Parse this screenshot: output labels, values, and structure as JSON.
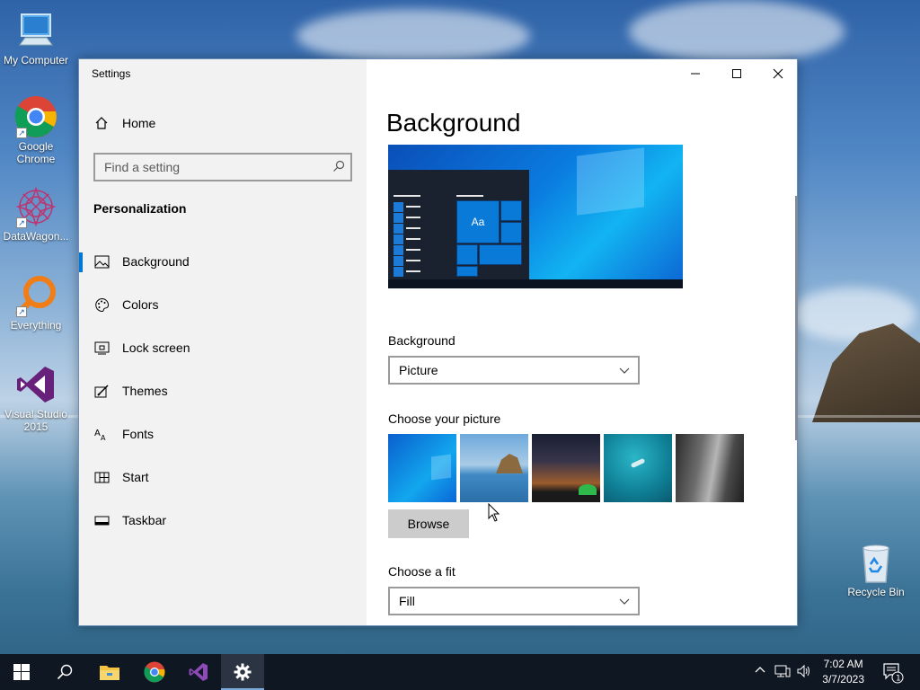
{
  "desktop": {
    "icons": [
      {
        "label": "My Computer",
        "icon": "computer-icon"
      },
      {
        "label": "Google Chrome",
        "icon": "chrome-icon"
      },
      {
        "label": "DataWagon...",
        "icon": "datawagon-icon"
      },
      {
        "label": "Everything",
        "icon": "everything-icon"
      },
      {
        "label": "Visual Studio 2015",
        "icon": "visual-studio-icon"
      },
      {
        "label": "Recycle Bin",
        "icon": "recycle-bin-icon"
      }
    ]
  },
  "window": {
    "title": "Settings",
    "caption_buttons": {
      "minimize": "─",
      "maximize": "☐",
      "close": "✕"
    }
  },
  "sidebar": {
    "home_label": "Home",
    "search_placeholder": "Find a setting",
    "section_title": "Personalization",
    "items": [
      {
        "label": "Background",
        "icon": "picture-icon",
        "selected": true
      },
      {
        "label": "Colors",
        "icon": "palette-icon",
        "selected": false
      },
      {
        "label": "Lock screen",
        "icon": "lock-screen-icon",
        "selected": false
      },
      {
        "label": "Themes",
        "icon": "themes-icon",
        "selected": false
      },
      {
        "label": "Fonts",
        "icon": "fonts-icon",
        "selected": false
      },
      {
        "label": "Start",
        "icon": "start-icon",
        "selected": false
      },
      {
        "label": "Taskbar",
        "icon": "taskbar-icon",
        "selected": false
      }
    ]
  },
  "content": {
    "page_title": "Background",
    "preview_tile_text": "Aa",
    "background_label": "Background",
    "background_value": "Picture",
    "choose_picture_label": "Choose your picture",
    "browse_label": "Browse",
    "choose_fit_label": "Choose a fit",
    "fit_value": "Fill"
  },
  "taskbar": {
    "apps": [
      "start-icon",
      "search-icon",
      "file-explorer-icon",
      "chrome-icon",
      "visual-studio-icon",
      "settings-gear-icon"
    ],
    "clock_time": "7:02 AM",
    "clock_date": "3/7/2023",
    "notification_count": "1"
  },
  "colors": {
    "accent": "#0078d7",
    "taskbar": "#0f1723",
    "sidebar": "#f2f2f2"
  }
}
